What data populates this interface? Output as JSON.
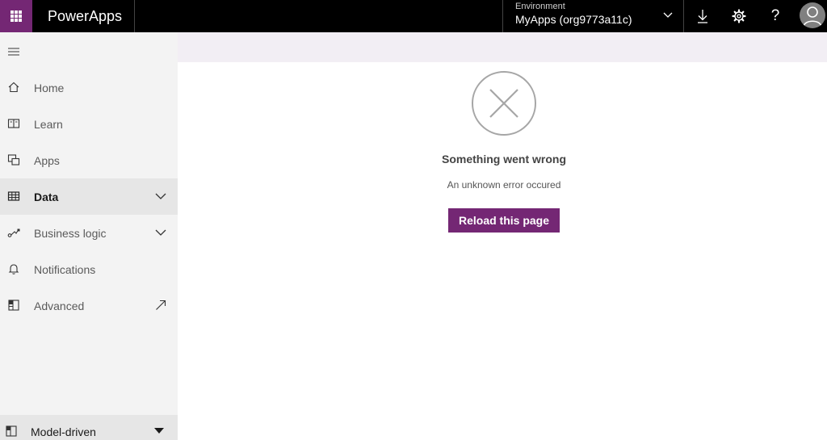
{
  "header": {
    "app_name": "PowerApps",
    "environment_label": "Environment",
    "environment_value": "MyApps (org9773a11c)",
    "help_glyph": "?",
    "icons": [
      "waffle-icon",
      "chevron-down-icon",
      "download-icon",
      "gear-icon",
      "help-icon",
      "avatar-icon"
    ]
  },
  "sidebar": {
    "items": [
      {
        "label": "Home",
        "icon": "home-icon"
      },
      {
        "label": "Learn",
        "icon": "book-icon"
      },
      {
        "label": "Apps",
        "icon": "apps-icon"
      },
      {
        "label": "Data",
        "icon": "table-icon",
        "active": true
      },
      {
        "label": "Business logic",
        "icon": "flow-icon"
      },
      {
        "label": "Notifications",
        "icon": "bell-icon"
      },
      {
        "label": "Advanced",
        "icon": "advanced-icon"
      }
    ],
    "bottom": {
      "label": "Model-driven",
      "icon": "model-icon"
    }
  },
  "error": {
    "title": "Something went wrong",
    "message": "An unknown error occured",
    "button_label": "Reload this page"
  },
  "colors": {
    "brand": "#742774",
    "topbar": "#000000",
    "sidebar_bg": "#f3f3f3",
    "active_bg": "#e6e6e6",
    "strip_bg": "#f2eef4"
  }
}
